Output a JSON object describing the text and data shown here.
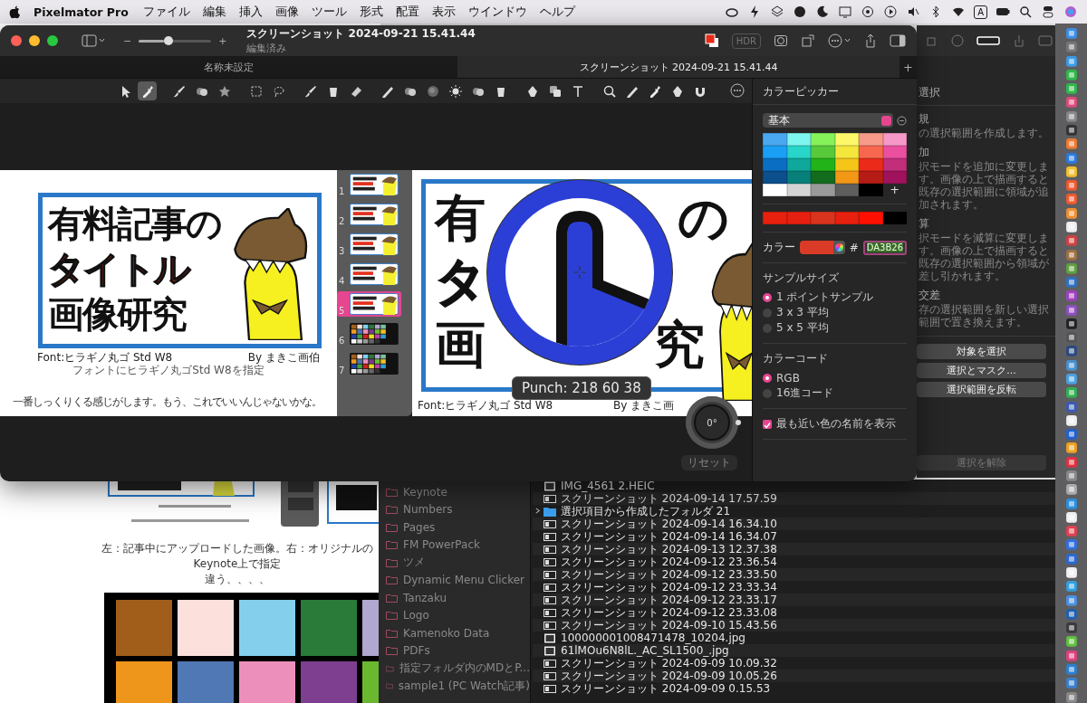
{
  "menubar": {
    "app": "Pixelmator Pro",
    "menus": [
      "ファイル",
      "編集",
      "挿入",
      "画像",
      "ツール",
      "形式",
      "配置",
      "表示",
      "ウインドウ",
      "ヘルプ"
    ],
    "input_indicator": "A"
  },
  "window": {
    "title": "スクリーンショット 2024-09-21 15.41.44",
    "subtitle": "編集済み",
    "zoom_out": "−",
    "zoom_in": "+",
    "zoom": {
      "level": 0.35
    },
    "hdr": "HDR",
    "tabs": [
      {
        "label": "名称未設定",
        "selected": false
      },
      {
        "label": "スクリーンショット 2024-09-21 15.41.44",
        "selected": true
      }
    ],
    "add_tab": "+"
  },
  "tool_groups": [
    [
      {
        "kind": "pointer",
        "selected": false
      },
      {
        "kind": "eyedropper",
        "selected": true
      }
    ],
    [
      {
        "kind": "brush",
        "selected": false
      },
      {
        "kind": "circles",
        "selected": false
      },
      {
        "kind": "star",
        "selected": false
      }
    ],
    [
      {
        "kind": "marquee",
        "selected": false
      },
      {
        "kind": "lasso",
        "selected": false
      }
    ],
    [
      {
        "kind": "brush",
        "selected": false
      },
      {
        "kind": "bucket",
        "selected": false
      },
      {
        "kind": "eraser",
        "selected": false
      }
    ],
    [
      {
        "kind": "pencil",
        "selected": false
      },
      {
        "kind": "circles",
        "selected": false
      },
      {
        "kind": "sphere",
        "selected": false
      },
      {
        "kind": "sun",
        "selected": false
      },
      {
        "kind": "circles",
        "selected": false
      },
      {
        "kind": "bucket",
        "selected": false
      }
    ],
    [
      {
        "kind": "pen",
        "selected": false
      },
      {
        "kind": "squares",
        "selected": false
      },
      {
        "kind": "text",
        "selected": false
      }
    ],
    [
      {
        "kind": "zoom",
        "selected": false
      },
      {
        "kind": "pencil",
        "selected": false
      },
      {
        "kind": "eyedropper",
        "selected": false
      },
      {
        "kind": "pen",
        "selected": false
      },
      {
        "kind": "magnet",
        "selected": false
      }
    ]
  ],
  "canvas": {
    "page": {
      "heading_lines": [
        {
          "text": "有料記事の",
          "kind": "plain"
        },
        {
          "text": "タイトル",
          "kind": "accent"
        },
        {
          "text": "画像研究",
          "kind": "plain"
        }
      ],
      "font_note": "Font:ヒラギノ丸ゴ Std W8",
      "credit": "By まきこ画伯",
      "caption": "フォントにヒラギノ丸ゴStd W8を指定",
      "body": "一番しっくりくる感じがします。もう、これでいいんじゃないかな。"
    },
    "slides": [
      {
        "number": "1",
        "kind": "title",
        "selected": false
      },
      {
        "number": "2",
        "kind": "title",
        "selected": false
      },
      {
        "number": "3",
        "kind": "title",
        "selected": false
      },
      {
        "number": "4",
        "kind": "title",
        "selected": false
      },
      {
        "number": "5",
        "kind": "title",
        "selected": true
      },
      {
        "number": "6",
        "kind": "chart",
        "selected": false
      },
      {
        "number": "7",
        "kind": "chart",
        "selected": false
      }
    ],
    "slide": {
      "lines": [
        [
          {
            "text": "有",
            "kind": "plain"
          },
          {
            "text": "の",
            "kind": "plain"
          }
        ],
        [
          {
            "text": "タ",
            "kind": "accent"
          }
        ],
        [
          {
            "text": "画",
            "kind": "plain"
          },
          {
            "text": "究",
            "kind": "plain"
          }
        ]
      ],
      "font_note": "Font:ヒラギノ丸ゴ Std W8",
      "credit": "By まきこ画"
    },
    "loupe_readout": "Punch: 218 60 38",
    "rotation": {
      "angle": "0°",
      "reset": "リセット"
    }
  },
  "color_picker": {
    "title": "カラーピッカー",
    "palette": "基本",
    "swatches": [
      {
        "color": "#4aa8f0"
      },
      {
        "color": "#7ef5ee"
      },
      {
        "color": "#86f25a"
      },
      {
        "color": "#fdf86a"
      },
      {
        "color": "#f79a8a"
      },
      {
        "color": "#f799c8"
      },
      {
        "color": "#1a9ff5"
      },
      {
        "color": "#27d6c8"
      },
      {
        "color": "#58c93a"
      },
      {
        "color": "#f5e63c"
      },
      {
        "color": "#f7674e"
      },
      {
        "color": "#ea4fa0"
      },
      {
        "color": "#0a6fc2"
      },
      {
        "color": "#0ea89c"
      },
      {
        "color": "#22b318"
      },
      {
        "color": "#f5c518"
      },
      {
        "color": "#ec2a1a"
      },
      {
        "color": "#c22e7a"
      },
      {
        "color": "#0b4f8c"
      },
      {
        "color": "#08807a"
      },
      {
        "color": "#136b1d"
      },
      {
        "color": "#f29716"
      },
      {
        "color": "#b51c16"
      },
      {
        "color": "#a0125e"
      },
      {
        "color": "#ffffff"
      },
      {
        "color": "#d4d4d4"
      },
      {
        "color": "#9a9a9a"
      },
      {
        "color": "#5e5e5e"
      },
      {
        "color": "#000000"
      }
    ],
    "add_label": "+",
    "recent": [
      {
        "color": "#e8200e"
      },
      {
        "color": "#e62010"
      },
      {
        "color": "#d9341e"
      },
      {
        "color": "#e8200e"
      },
      {
        "color": "#ff1000"
      },
      {
        "color": "#000000"
      }
    ],
    "color_label": "カラー",
    "hash": "#",
    "hex": "DA3B26",
    "sample_size": {
      "title": "サンプルサイズ",
      "options": [
        {
          "label": "1 ポイントサンプル",
          "selected": true
        },
        {
          "label": "3 x 3 平均",
          "selected": false
        },
        {
          "label": "5 x 5 平均",
          "selected": false
        }
      ]
    },
    "color_code": {
      "title": "カラーコード",
      "options": [
        {
          "label": "RGB",
          "selected": true
        },
        {
          "label": "16進コード",
          "selected": false
        }
      ]
    },
    "nearest_name": {
      "label": "最も近い色の名前を表示",
      "checked": true
    }
  },
  "select_panel": {
    "title": "選択",
    "options": [
      {
        "title": "規",
        "description": "の選択範囲を作成します。"
      },
      {
        "title": "加",
        "description": "択モードを追加に変更します。画像の上で描画すると既存の選択範囲に領域が追加されます。"
      },
      {
        "title": "算",
        "description": "択モードを減算に変更します。画像の上で描画すると既存の選択範囲から領域が差し引かれます。"
      },
      {
        "title": "交差",
        "description": "存の選択範囲を新しい選択範囲で置き換えます。"
      }
    ],
    "buttons": [
      {
        "label": "対象を選択",
        "disabled": false
      },
      {
        "label": "選択とマスク...",
        "disabled": false
      },
      {
        "label": "選択範囲を反転",
        "disabled": false
      }
    ],
    "clear": {
      "label": "選択を解除",
      "disabled": true
    }
  },
  "finder": {
    "sidebar": [
      "Keynote",
      "Numbers",
      "Pages",
      "FM PowerPack",
      "ツメ",
      "Dynamic Menu Clicker",
      "Tanzaku",
      "Logo",
      "Kamenoko Data",
      "PDFs",
      "指定フォルダ内のMDとP...",
      "sample1 (PC Watch記事)"
    ],
    "files": [
      {
        "kind": "photo",
        "name": "IMG_4561 2.HEIC"
      },
      {
        "kind": "screenshot",
        "name": "スクリーンショット 2024-09-14 17.57.59"
      },
      {
        "kind": "folder",
        "name": "選択項目から作成したフォルダ 21",
        "expanded": false
      },
      {
        "kind": "screenshot",
        "name": "スクリーンショット 2024-09-14 16.34.10"
      },
      {
        "kind": "screenshot",
        "name": "スクリーンショット 2024-09-14 16.34.07"
      },
      {
        "kind": "screenshot",
        "name": "スクリーンショット 2024-09-13 12.37.38"
      },
      {
        "kind": "screenshot",
        "name": "スクリーンショット 2024-09-12 23.36.54"
      },
      {
        "kind": "screenshot",
        "name": "スクリーンショット 2024-09-12 23.33.50"
      },
      {
        "kind": "screenshot",
        "name": "スクリーンショット 2024-09-12 23.33.34"
      },
      {
        "kind": "screenshot",
        "name": "スクリーンショット 2024-09-12 23.33.17"
      },
      {
        "kind": "screenshot",
        "name": "スクリーンショット 2024-09-12 23.33.08"
      },
      {
        "kind": "screenshot",
        "name": "スクリーンショット 2024-09-10 15.43.56"
      },
      {
        "kind": "photo",
        "name": "100000001008471478_10204.jpg"
      },
      {
        "kind": "photo",
        "name": "61lMOu6N8lL._AC_SL1500_.jpg"
      },
      {
        "kind": "screenshot",
        "name": "スクリーンショット 2024-09-09 10.09.32"
      },
      {
        "kind": "screenshot",
        "name": "スクリーンショット 2024-09-09 10.05.26"
      },
      {
        "kind": "screenshot",
        "name": "スクリーンショット 2024-09-09 0.15.53"
      }
    ]
  },
  "web_page": {
    "caption_lines": [
      "左：記事中にアップロードした画像。右：オリジナルのKeynote上で指定",
      "違う、、、、"
    ]
  }
}
